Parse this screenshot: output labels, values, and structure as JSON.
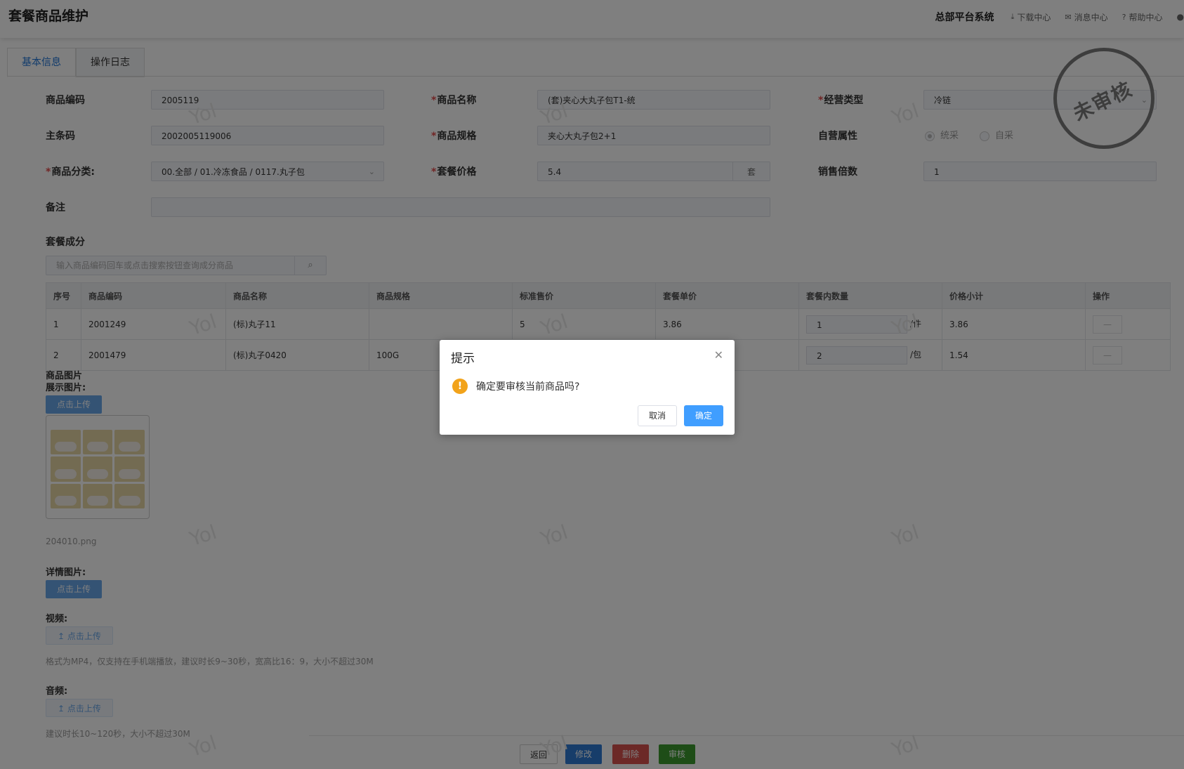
{
  "header": {
    "page_title": "套餐商品维护",
    "system_name": "总部平台系统",
    "links": [
      {
        "label": "下载中心",
        "icon": "download-icon"
      },
      {
        "label": "消息中心",
        "icon": "mail-icon"
      },
      {
        "label": "帮助中心",
        "icon": "help-icon"
      }
    ]
  },
  "tabs": [
    "基本信息",
    "操作日志"
  ],
  "stamp": "未审核",
  "form": {
    "code_label": "商品编码",
    "code_value": "2005119",
    "name_label": "商品名称",
    "name_value": "(套)夹心大丸子包T1-统",
    "biz_type_label": "经营类型",
    "biz_type_value": "冷链",
    "barcode_label": "主条码",
    "barcode_value": "2002005119006",
    "spec_label": "商品规格",
    "spec_value": "夹心大丸子包2+1",
    "self_label": "自营属性",
    "self_options": [
      "统采",
      "自采"
    ],
    "self_selected": "统采",
    "category_label": "商品分类:",
    "category_value": "00.全部 / 01.冷冻食品 / 0117.丸子包",
    "price_label": "套餐价格",
    "price_value": "5.4",
    "price_unit": "套",
    "multiple_label": "销售倍数",
    "multiple_value": "1",
    "remark_label": "备注",
    "remark_value": ""
  },
  "components": {
    "title": "套餐成分",
    "search_placeholder": "输入商品编码回车或点击搜索按钮查询成分商品",
    "columns": [
      "序号",
      "商品编码",
      "商品名称",
      "商品规格",
      "标准售价",
      "套餐单价",
      "套餐内数量",
      "价格小计",
      "操作"
    ],
    "rows": [
      {
        "no": "1",
        "code": "2001249",
        "name": "(标)丸子11",
        "spec": "",
        "std_price": "5",
        "unit_price": "3.86",
        "qty": "1",
        "unit": "/件",
        "subtotal": "3.86",
        "op": "—"
      },
      {
        "no": "2",
        "code": "2001479",
        "name": "(标)丸子0420",
        "spec": "100G",
        "std_price": "",
        "unit_price": "",
        "qty": "2",
        "unit": "/包",
        "subtotal": "1.54",
        "op": "—"
      }
    ]
  },
  "media": {
    "image_title": "商品图片",
    "display_label": "展示图片:",
    "upload_label": "点击上传",
    "display_file": "204010.png",
    "detail_label": "详情图片:",
    "video_label": "视频:",
    "upload_label_icon": "↥ 点击上传",
    "video_hint": "格式为MP4，仅支持在手机端播放，建议时长9~30秒，宽高比16：9，大小不超过30M",
    "audio_label": "音频:",
    "audio_hint": "建议时长10~120秒，大小不超过30M"
  },
  "footer": {
    "back": "返回",
    "edit": "修改",
    "delete": "删除",
    "audit": "审核",
    "colors": {
      "edit": "#2e7bd4",
      "delete": "#d9534f",
      "audit": "#3c9a2f"
    }
  },
  "watermark": "Yol",
  "dialog": {
    "title": "提示",
    "message": "确定要审核当前商品吗?",
    "cancel": "取消",
    "confirm": "确定"
  }
}
